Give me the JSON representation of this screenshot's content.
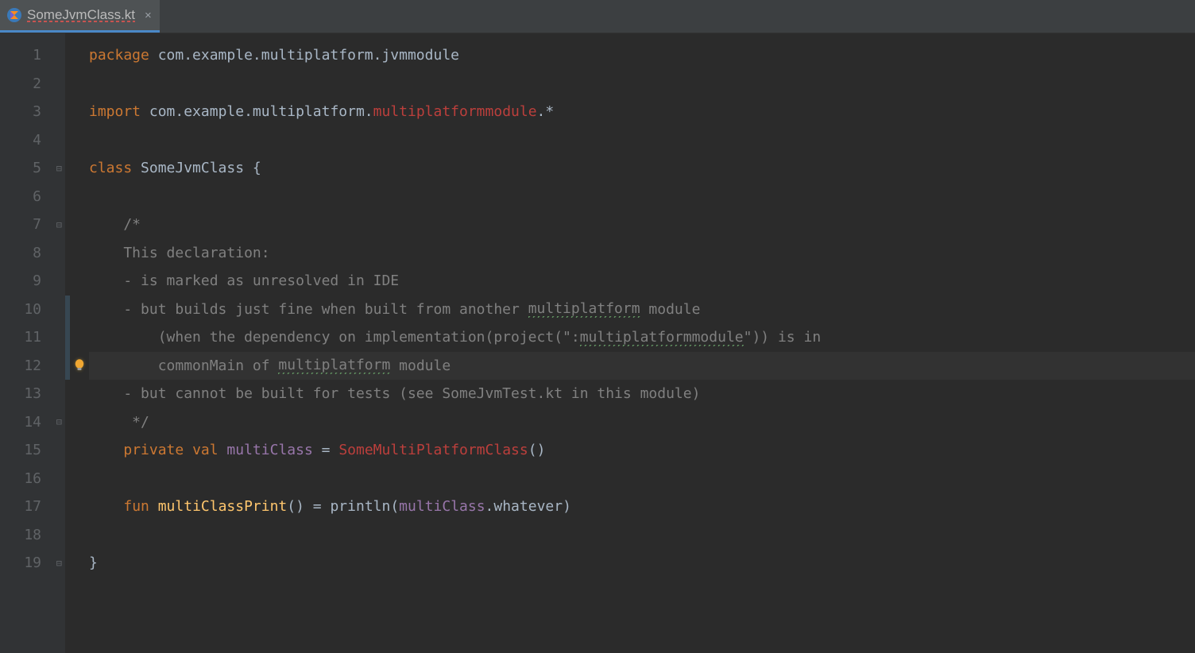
{
  "tab": {
    "filename": "SomeJvmClass.kt",
    "close_glyph": "×"
  },
  "gutter": {
    "lines": [
      "1",
      "2",
      "3",
      "4",
      "5",
      "6",
      "7",
      "8",
      "9",
      "10",
      "11",
      "12",
      "13",
      "14",
      "15",
      "16",
      "17",
      "18",
      "19"
    ],
    "folds": {
      "5": "⊟",
      "7": "⊟",
      "14": "⊟",
      "19": "⊟"
    }
  },
  "icons": {
    "bulb_line": 12
  },
  "code": {
    "l1": {
      "kw": "package",
      "rest": " com.example.multiplatform.jvmmodule"
    },
    "l3": {
      "kw": "import",
      "mid": " com.example.multiplatform.",
      "err": "multiplatformmodule",
      "tail": ".*"
    },
    "l5": {
      "kw1": "class",
      "name": " SomeJvmClass ",
      "brace": "{"
    },
    "l7": "    /*",
    "l8": "    This declaration:",
    "l9": "    - is marked as unresolved in IDE",
    "l10a": "    - but builds just fine when built from another ",
    "l10b": "multiplatform",
    "l10c": " module",
    "l11a": "        (when the dependency on implementation(project(\":",
    "l11b": "multiplatformmodule",
    "l11c": "\")) is in",
    "l12a": "        commonMain of ",
    "l12b": "multiplatform",
    "l12c": " module",
    "l13": "    - but cannot be built for tests (see SomeJvmTest.kt in this module)",
    "l14": "     */",
    "l15": {
      "pad": "    ",
      "kw1": "private",
      "sp1": " ",
      "kw2": "val",
      "sp2": " ",
      "name": "multiClass",
      "eq": " = ",
      "err": "SomeMultiPlatformClass",
      "paren": "()"
    },
    "l17": {
      "pad": "    ",
      "kw": "fun",
      "sp": " ",
      "fn": "multiClassPrint",
      "mid": "() = println(",
      "prop": "multiClass",
      "tail": ".whatever)"
    },
    "l19": "}"
  },
  "highlight_line": 12
}
